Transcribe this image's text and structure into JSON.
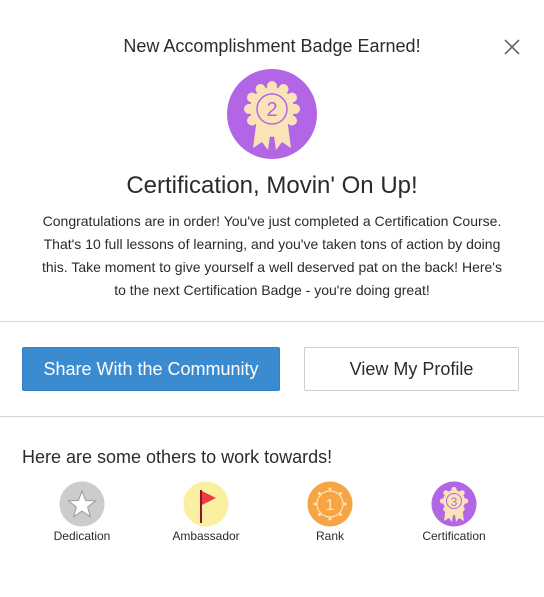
{
  "modal": {
    "header_title": "New Accomplishment Badge Earned!",
    "close_icon": "close-icon",
    "badge": {
      "number": "2",
      "icon": "rosette-badge-icon",
      "circle_color": "#b266e6",
      "rosette_color": "#fbe3b8",
      "title": "Certification, Movin' On Up!",
      "description": "Congratulations are in order! You've just completed a Certification Course. That's 10 full lessons of learning, and you've taken tons of action by doing this. Take moment to give yourself a well deserved pat on the back! Here's to the next Certification Badge - you're doing great!"
    },
    "actions": {
      "share_label": "Share With the Community",
      "profile_label": "View My Profile",
      "share_color": "#3b8bd0"
    },
    "others": {
      "heading": "Here are some others to work towards!",
      "badges": [
        {
          "label": "Dedication",
          "icon": "star-badge-icon",
          "color": "#cccccc"
        },
        {
          "label": "Ambassador",
          "icon": "flag-badge-icon",
          "color": "#fbf0a0"
        },
        {
          "label": "Rank",
          "icon": "rank-badge-icon",
          "number": "1",
          "color": "#f7a445"
        },
        {
          "label": "Certification",
          "icon": "certification-badge-icon",
          "number": "3",
          "color": "#b266e6"
        }
      ]
    }
  }
}
